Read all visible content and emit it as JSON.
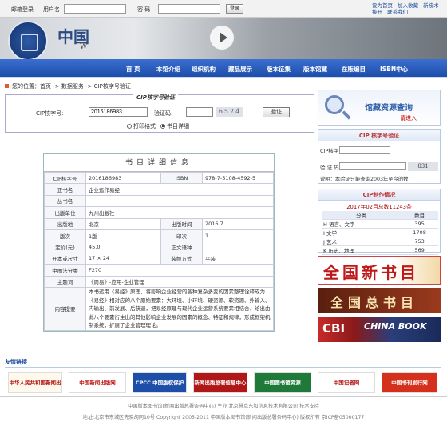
{
  "topbar": {
    "email_login": "邮箱登录",
    "username_label": "用户名",
    "password_label": "密 码",
    "login_button": "登录",
    "links": [
      "设为首页",
      "加入收藏",
      "新技术接开",
      "联系我们"
    ]
  },
  "banner": {
    "title": "中国",
    "subtitle": "W"
  },
  "nav": [
    "首 页",
    "本馆介绍",
    "组织机构",
    "藏品展示",
    "版本征集",
    "版本馆藏",
    "在版编目",
    "ISBN中心"
  ],
  "breadcrumb": "您的位置：首页 -> 数据服务 -> CIP核字号验证",
  "verify": {
    "title": "CIP核字号验证",
    "cip_label": "CIP核字号:",
    "cip_value": "2016186983",
    "code_label": "验证码:",
    "captcha": "6524",
    "button": "验证",
    "radio_print": "打印格式",
    "radio_detail": "书目详细"
  },
  "detail": {
    "title": "书目详细信息",
    "cip_label": "CIP核字号",
    "cip": "2016186983",
    "isbn_label": "ISBN",
    "isbn": "978-7-5108-4592-5",
    "title_label": "正书名",
    "book_title": "企业运作易经",
    "series_label": "丛书名",
    "series": "",
    "publisher_label": "出版单位",
    "publisher": "九州出版社",
    "place_label": "出版地",
    "place": "北京",
    "date_label": "出版时间",
    "date": "2016.7",
    "edition_label": "版次",
    "edition": "1版",
    "print_label": "印次",
    "print": "1",
    "price_label": "定价(元)",
    "price": "45.0",
    "lang_label": "正文语种",
    "lang": "",
    "size_label": "开本或尺寸",
    "size": "17 × 24",
    "binding_label": "装帧方式",
    "binding": "平装",
    "class_label": "中图法分类",
    "class": "F270",
    "subject_label": "主题词",
    "subject": "《周易》-应用-企业管理",
    "abstract_label": "内容提要",
    "abstract": "本书运用《易经》原理，将影响企业经营的各种复杂多变的因素整理诠释成为《易经》相对应的八个原始要素：大环境、小环境、硬资源、软资源、外输入、内输出、前发展、后获退，把易经原理与现代企业运营系统要素相结合，给出由此八个要素衍生出的其他影响企业发展的因素的概念、特征和规律，形成框架机制系统，扩展了企业管理理论。"
  },
  "right": {
    "search_title": "馆藏资源查询",
    "search_enter": "请进入",
    "cip_title": "CIP 核字号验证",
    "cip_label": "CIP核字号",
    "code_label": "验 证 码",
    "captcha": "831",
    "note": "说明：本验证只能查询2003年至今的数",
    "stats_title": "CIP制作情况",
    "stats_sub": "2017年02月总数11243条",
    "stats_head": [
      "分类",
      "数目"
    ],
    "stats_rows": [
      [
        "H 语言、文字",
        "395"
      ],
      [
        "I 文学",
        "1708"
      ],
      [
        "J 艺术",
        "753"
      ],
      [
        "K 历史、地理",
        "569"
      ]
    ]
  },
  "promos": {
    "p1": "全国新书目",
    "p2": "全国总书目",
    "p3a": "CBI",
    "p3b": "CHINA BOOK"
  },
  "friends": {
    "title": "友情链接",
    "logos": [
      "中华人民共和国新闻出版总署",
      "中国新闻出版网",
      "CPCC 中国版权保护中心",
      "新闻出版总署信息中心",
      "中国图书馆资源",
      "中国记者网",
      "中国书刊发行网"
    ]
  },
  "footer": {
    "line1": "中国版本图书馆(新闻出版总署条码中心) 主办      北京慧点东和信息技术有限公司 技术支持",
    "line2": "地址:北京市东城区先晓胡同10号 Copyright 2005-2011 中国版本图书馆(新闻出版总署条码中心) 版权所有 京ICP备05000177"
  }
}
